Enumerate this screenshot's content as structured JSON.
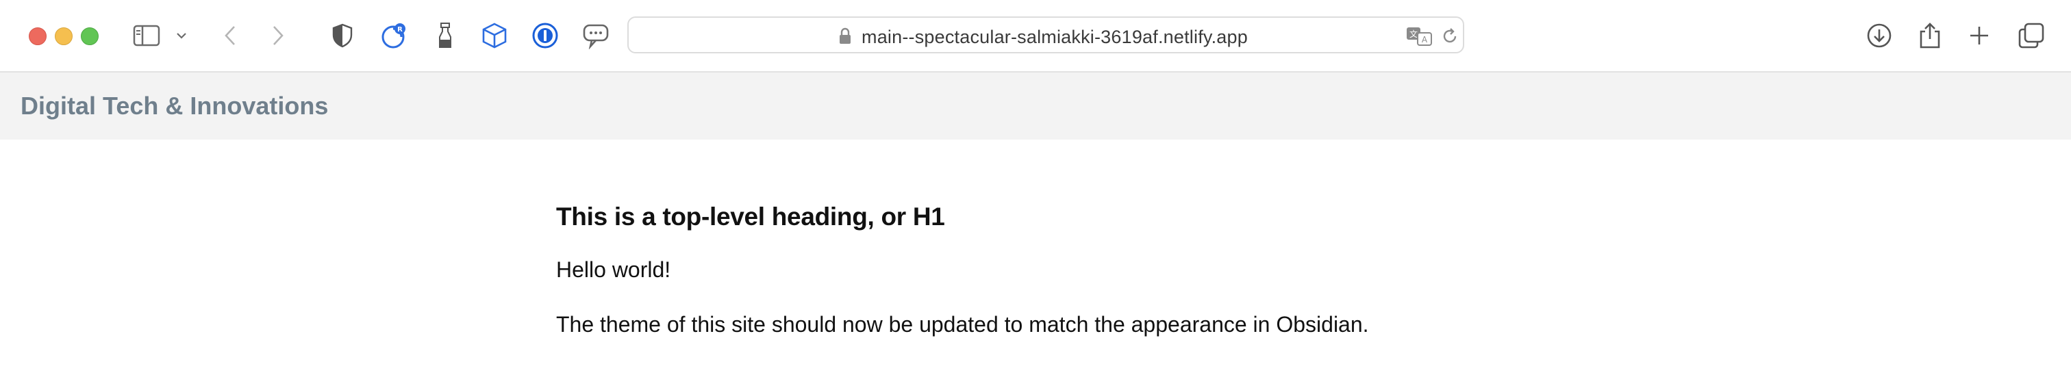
{
  "browser": {
    "url": "main--spectacular-salmiakki-3619af.netlify.app",
    "icons": [
      "sidebar-icon",
      "chevron-down-icon",
      "back-icon",
      "forward-icon",
      "shield-icon",
      "extension-badge-icon",
      "bottle-icon",
      "cube-icon",
      "onepassword-icon",
      "chat-icon",
      "lock-icon",
      "translate-icon",
      "reload-icon",
      "download-icon",
      "share-icon",
      "new-tab-icon",
      "tabs-overview-icon"
    ]
  },
  "site": {
    "title": "Digital Tech & Innovations"
  },
  "content": {
    "heading": "This is a top-level heading, or H1",
    "paragraphs": [
      "Hello world!",
      "The theme of this site should now be updated to match the appearance in Obsidian."
    ]
  },
  "colors": {
    "site_title": "#6f7f8c",
    "header_bg": "#f3f3f3",
    "text": "#111111"
  }
}
